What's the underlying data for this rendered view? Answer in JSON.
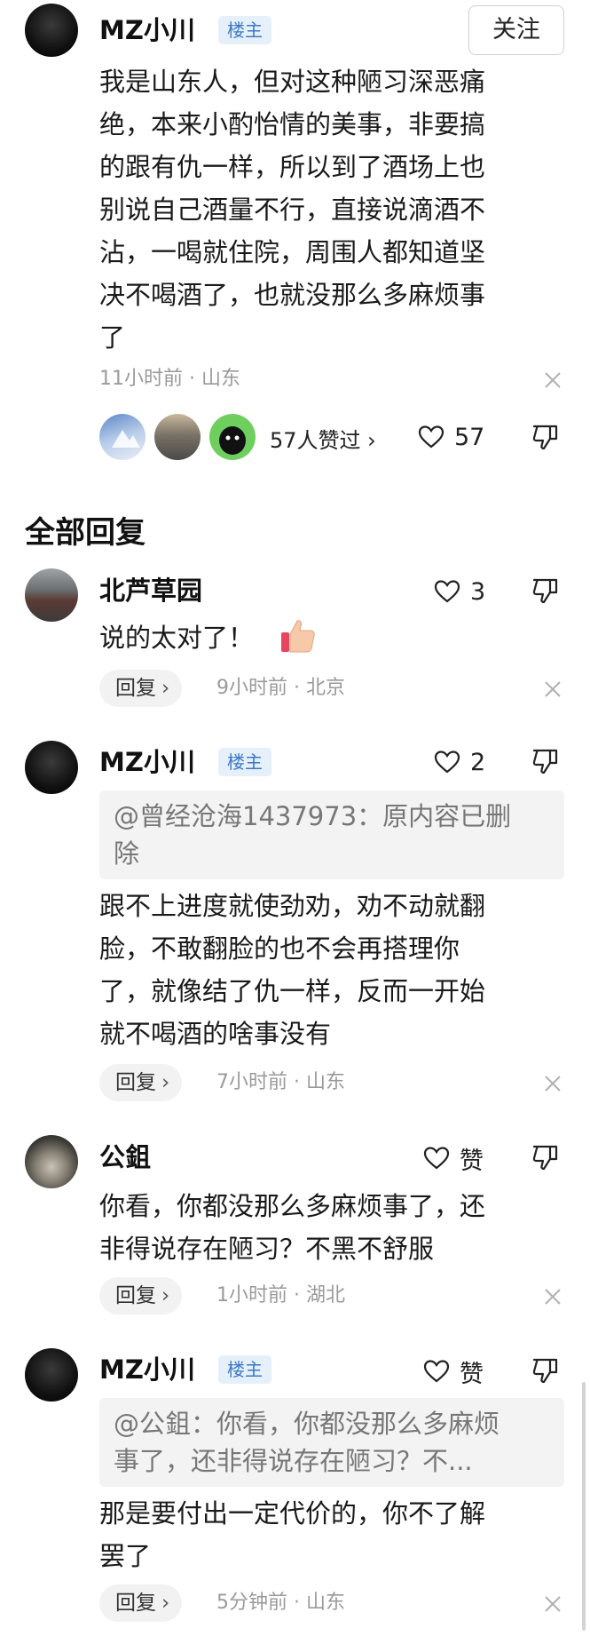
{
  "main_post": {
    "author": "MZ小川",
    "badge": "楼主",
    "follow_label": "关注",
    "lines": [
      "我是山东人，但对这种陋习深恶痛",
      "绝，本来小酌怡情的美事，非要搞",
      "的跟有仇一样，所以到了酒场上也",
      "别说自己酒量不行，直接说滴酒不",
      "沾，一喝就住院，周围人都知道坚",
      "决不喝酒了，也就没那么多麻烦事",
      "了"
    ],
    "meta": "11小时前 · 山东",
    "likers_text": "57人赞过 ›",
    "like_count": "57"
  },
  "section_title": "全部回复",
  "replies": [
    {
      "author": "北芦草园",
      "lines": [
        "说的太对了！"
      ],
      "reply_label": "回复",
      "reply_chevron": "›",
      "meta": "9小时前 · 北京",
      "like_count": "3"
    },
    {
      "author": "MZ小川",
      "badge": "楼主",
      "quote_lines": [
        "@曾经沧海1437973：原内容已删",
        "除"
      ],
      "lines": [
        "跟不上进度就使劲劝，劝不动就翻",
        "脸，不敢翻脸的也不会再搭理你",
        "了，就像结了仇一样，反而一开始",
        "就不喝酒的啥事没有"
      ],
      "reply_label": "回复",
      "reply_chevron": "›",
      "meta": "7小时前 · 山东",
      "like_count": "2"
    },
    {
      "author": "公鉏",
      "lines": [
        "你看，你都没那么多麻烦事了，还",
        "非得说存在陋习？不黑不舒服"
      ],
      "reply_label": "回复",
      "reply_chevron": "›",
      "meta": "1小时前 · 湖北",
      "like_count": "赞"
    },
    {
      "author": "MZ小川",
      "badge": "楼主",
      "quote_lines": [
        "@公鉏：你看，你都没那么多麻烦",
        "事了，还非得说存在陋习？不..."
      ],
      "lines": [
        "那是要付出一定代价的，你不了解",
        "罢了"
      ],
      "reply_label": "回复",
      "reply_chevron": "›",
      "meta": "5分钟前 · 山东",
      "like_count": "赞"
    }
  ],
  "colors": {
    "badge_bg": "#e6f0fb",
    "badge_text": "#3b79c6",
    "meta_text": "#9a9a9a",
    "pill_bg": "#f2f2f2",
    "quote_bg": "#f3f3f3"
  }
}
